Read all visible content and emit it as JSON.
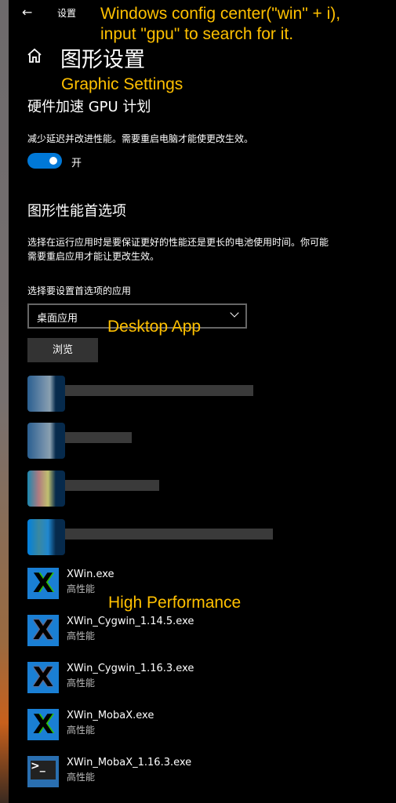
{
  "header": {
    "back_icon": "arrow-left-icon",
    "app_title": "设置",
    "page_title": "图形设置",
    "home_icon": "home-icon"
  },
  "annotations": {
    "top": "Windows config center(\"win\" + i),",
    "top2": "input \"gpu\" to search for it.",
    "graphic": "Graphic Settings",
    "desktop": "Desktop App",
    "high": "High Performance"
  },
  "gpu": {
    "heading": "硬件加速 GPU 计划",
    "description": "减少延迟并改进性能。需要重启电脑才能使更改生效。",
    "toggle_label": "开",
    "toggle_on": true,
    "accent": "#0078d7"
  },
  "pref": {
    "heading": "图形性能首选项",
    "description1": "选择在运行应用时是要保证更好的性能还是更长的电池使用时间。你可能",
    "description2": "需要重启应用才能让更改生效。",
    "select_label": "选择要设置首选项的应用",
    "select_value": "桌面应用",
    "browse": "浏览"
  },
  "apps": [
    {
      "name": "XWin.exe",
      "pref": "高性能",
      "icon": "x-logo-icon"
    },
    {
      "name": "XWin_Cygwin_1.14.5.exe",
      "pref": "高性能",
      "icon": "cygwin-x-icon"
    },
    {
      "name": "XWin_Cygwin_1.16.3.exe",
      "pref": "高性能",
      "icon": "cygwin-x-icon"
    },
    {
      "name": "XWin_MobaX.exe",
      "pref": "高性能",
      "icon": "x-logo-icon"
    },
    {
      "name": "XWin_MobaX_1.16.3.exe",
      "pref": "高性能",
      "icon": "terminal-icon"
    }
  ]
}
